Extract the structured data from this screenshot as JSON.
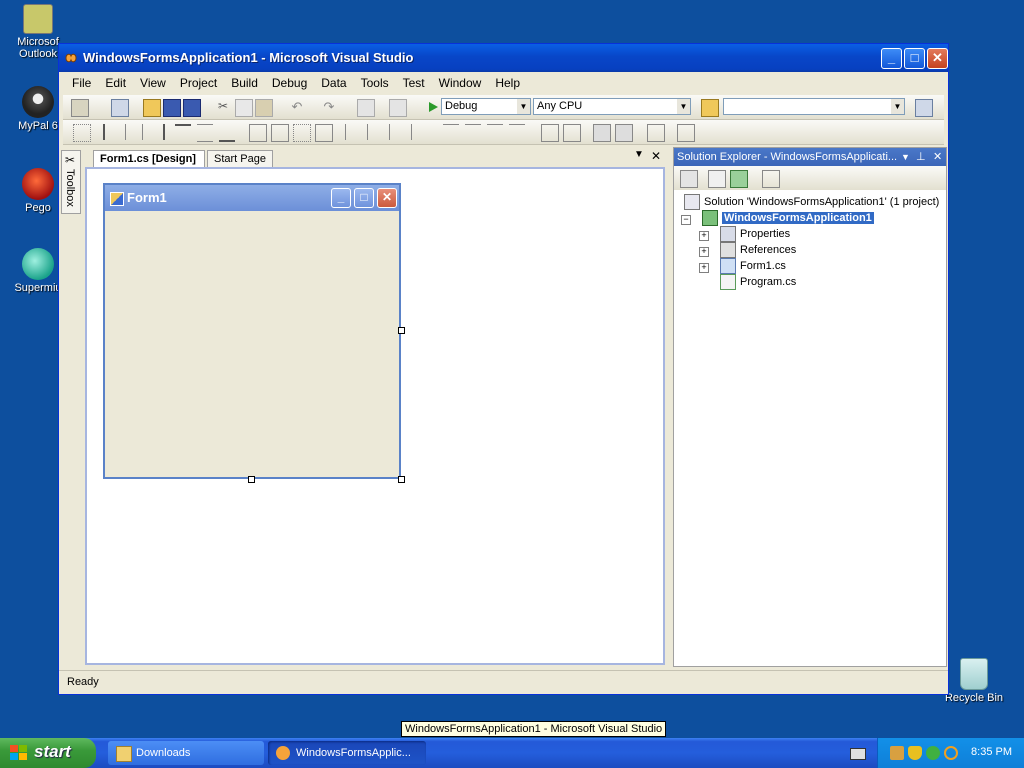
{
  "desktop": {
    "icons": [
      {
        "label": "Microsoft Outlook",
        "line1": "Microsof",
        "line2": "Outlook"
      },
      {
        "label": "MyPal 6",
        "line1": "MyPal 6",
        "line2": ""
      },
      {
        "label": "Pego",
        "line1": "Pego",
        "line2": ""
      },
      {
        "label": "Supermium",
        "line1": "Supermiu",
        "line2": ""
      },
      {
        "label": "Recycle Bin",
        "line1": "Recycle Bin",
        "line2": ""
      }
    ]
  },
  "window": {
    "title": "WindowsFormsApplication1 - Microsoft Visual Studio",
    "minimize": "_",
    "maximize": "□",
    "close": "✕"
  },
  "menu": [
    "File",
    "Edit",
    "View",
    "Project",
    "Build",
    "Debug",
    "Data",
    "Tools",
    "Test",
    "Window",
    "Help"
  ],
  "toolbar": {
    "config": "Debug",
    "platform": "Any CPU",
    "find": ""
  },
  "toolbox": {
    "label": "Toolbox"
  },
  "tabs": [
    {
      "label": "Form1.cs [Design]",
      "active": true
    },
    {
      "label": "Start Page",
      "active": false
    }
  ],
  "designer": {
    "form_title": "Form1"
  },
  "solution_explorer": {
    "title": "Solution Explorer - WindowsFormsApplicati...",
    "solution": "Solution 'WindowsFormsApplication1' (1 project)",
    "project": "WindowsFormsApplication1",
    "items": [
      "Properties",
      "References",
      "Form1.cs",
      "Program.cs"
    ]
  },
  "status": {
    "text": "Ready"
  },
  "tooltip": {
    "text": "WindowsFormsApplication1 - Microsoft Visual Studio"
  },
  "taskbar": {
    "start": "start",
    "buttons": [
      "Downloads",
      "WindowsFormsApplic..."
    ],
    "clock": "8:35 PM"
  },
  "colors": {
    "desktop": "#0d4f9e",
    "titlebar": "#0a5fe4",
    "selection": "#316ac5",
    "taskbar": "#245edc",
    "start": "#3a9a3a"
  }
}
